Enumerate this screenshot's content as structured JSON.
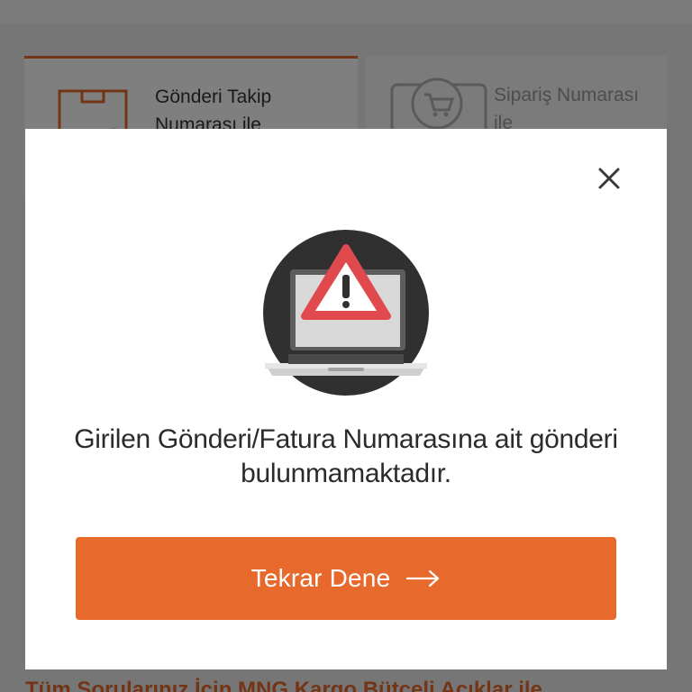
{
  "tabs": [
    {
      "label": "Gönderi Takip Numarası ile",
      "active": true,
      "icon": "package-barcode-icon"
    },
    {
      "label": "Sipariş Numarası ile",
      "active": false,
      "icon": "shopping-cart-icon"
    }
  ],
  "background_text": "Tüm Sorularınız İçin MNG Kargo Bütçeli Açıklar ile",
  "modal": {
    "illustration": "laptop-warning-icon",
    "message": "Girilen Gönderi/Fatura Numarasına ait gönderi bulunmamaktadır.",
    "retry_label": "Tekrar Dene",
    "retry_icon": "arrow-right-icon",
    "close_icon": "close-icon"
  },
  "colors": {
    "accent": "#e8692c",
    "overlay": "rgba(0,0,0,0.5)",
    "warning_red": "#e04a4f"
  }
}
